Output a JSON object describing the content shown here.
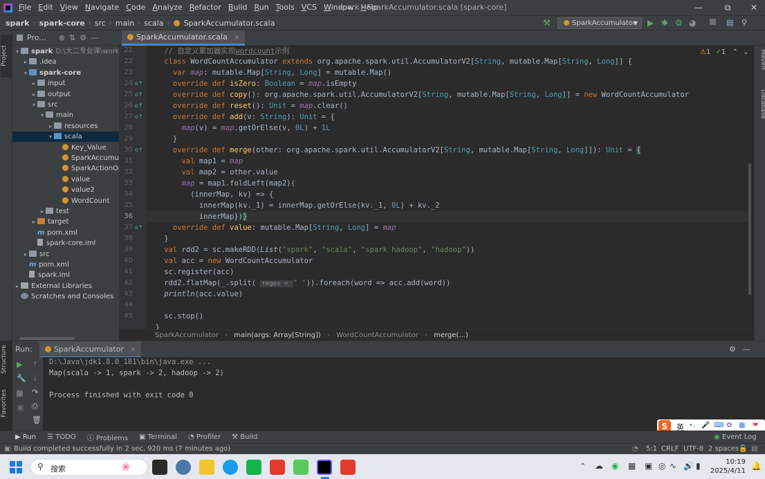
{
  "window": {
    "title": "spark - SparkAccumulator.scala [spark-core]",
    "menus": [
      "File",
      "Edit",
      "View",
      "Navigate",
      "Code",
      "Analyze",
      "Refactor",
      "Build",
      "Run",
      "Tools",
      "VCS",
      "Window",
      "Help"
    ]
  },
  "breadcrumb": [
    "spark",
    "spark-core",
    "src",
    "main",
    "scala",
    "SparkAccumulator.scala"
  ],
  "run_config": "SparkAccumulator",
  "project_panel": {
    "title": "Pro...",
    "tree": [
      {
        "label": "spark",
        "extra": "D:\\大二专业课\\workSpace\\",
        "depth": 0,
        "icon": "folder",
        "open": true
      },
      {
        "label": ".idea",
        "depth": 1,
        "icon": "folder",
        "open": false
      },
      {
        "label": "spark-core",
        "depth": 1,
        "icon": "folder-blue",
        "open": true
      },
      {
        "label": "input",
        "depth": 2,
        "icon": "folder",
        "open": false
      },
      {
        "label": "output",
        "depth": 2,
        "icon": "folder",
        "open": false
      },
      {
        "label": "src",
        "depth": 2,
        "icon": "folder",
        "open": true
      },
      {
        "label": "main",
        "depth": 3,
        "icon": "folder",
        "open": true
      },
      {
        "label": "resources",
        "depth": 4,
        "icon": "folder",
        "open": false
      },
      {
        "label": "scala",
        "depth": 4,
        "icon": "folder-blue",
        "open": true,
        "selected": true
      },
      {
        "label": "Key_Value",
        "depth": 5,
        "icon": "package"
      },
      {
        "label": "SparkAccumulato",
        "depth": 5,
        "icon": "scala"
      },
      {
        "label": "SparkActionOper",
        "depth": 5,
        "icon": "scala"
      },
      {
        "label": "value",
        "depth": 5,
        "icon": "scala"
      },
      {
        "label": "value2",
        "depth": 5,
        "icon": "scala"
      },
      {
        "label": "WordCount",
        "depth": 5,
        "icon": "scala"
      },
      {
        "label": "test",
        "depth": 3,
        "icon": "folder",
        "open": false
      },
      {
        "label": "target",
        "depth": 2,
        "icon": "folder-orange",
        "open": false
      },
      {
        "label": "pom.xml",
        "depth": 2,
        "icon": "maven"
      },
      {
        "label": "spark-core.iml",
        "depth": 2,
        "icon": "file"
      },
      {
        "label": "src",
        "depth": 1,
        "icon": "folder",
        "open": false
      },
      {
        "label": "pom.xml",
        "depth": 1,
        "icon": "maven"
      },
      {
        "label": "spark.iml",
        "depth": 1,
        "icon": "file"
      },
      {
        "label": "External Libraries",
        "depth": 0,
        "icon": "lib",
        "open": false
      },
      {
        "label": "Scratches and Consoles",
        "depth": 0,
        "icon": "scratch"
      }
    ]
  },
  "editor": {
    "tab": "SparkAccumulator.scala",
    "inspections": {
      "warnings": "1",
      "ok": "1"
    },
    "line_numbers": [
      "21",
      "22",
      "23",
      "24",
      "25",
      "26",
      "27",
      "28",
      "29",
      "30",
      "31",
      "32",
      "33",
      "34",
      "35",
      "36",
      "37",
      "38",
      "39",
      "40",
      "41",
      "42",
      "43",
      "44",
      "45"
    ],
    "current_line": "36",
    "breadcrumbs": [
      "SparkAccumulator",
      "main(args: Array[String])",
      "WordCountAccumulator",
      "merge(...)"
    ]
  },
  "run": {
    "label": "Run:",
    "tab": "SparkAccumulator",
    "output": [
      "D:\\Java\\jdk1.8.0_181\\bin\\java.exe ...",
      "Map(scala -> 1, spark -> 2, hadoop -> 2)",
      "",
      "Process finished with exit code 0"
    ]
  },
  "bottom_tabs": [
    "Run",
    "TODO",
    "Problems",
    "Terminal",
    "Profiler",
    "Build"
  ],
  "event_log": "Event Log",
  "status": {
    "message": "Build completed successfully in 2 sec, 920 ms (7 minutes ago)",
    "position": "5:1",
    "line_sep": "CRLF",
    "encoding": "UTF-8",
    "indent": "2 spaces"
  },
  "side_tabs": {
    "left_top": "Project",
    "left_bottom": [
      "Structure",
      "Favorites"
    ],
    "right": [
      "Maven",
      "Database"
    ]
  },
  "ime": {
    "lang": "英"
  },
  "taskbar": {
    "search": "搜索",
    "time": "10:19",
    "date": "2025/4/11"
  }
}
